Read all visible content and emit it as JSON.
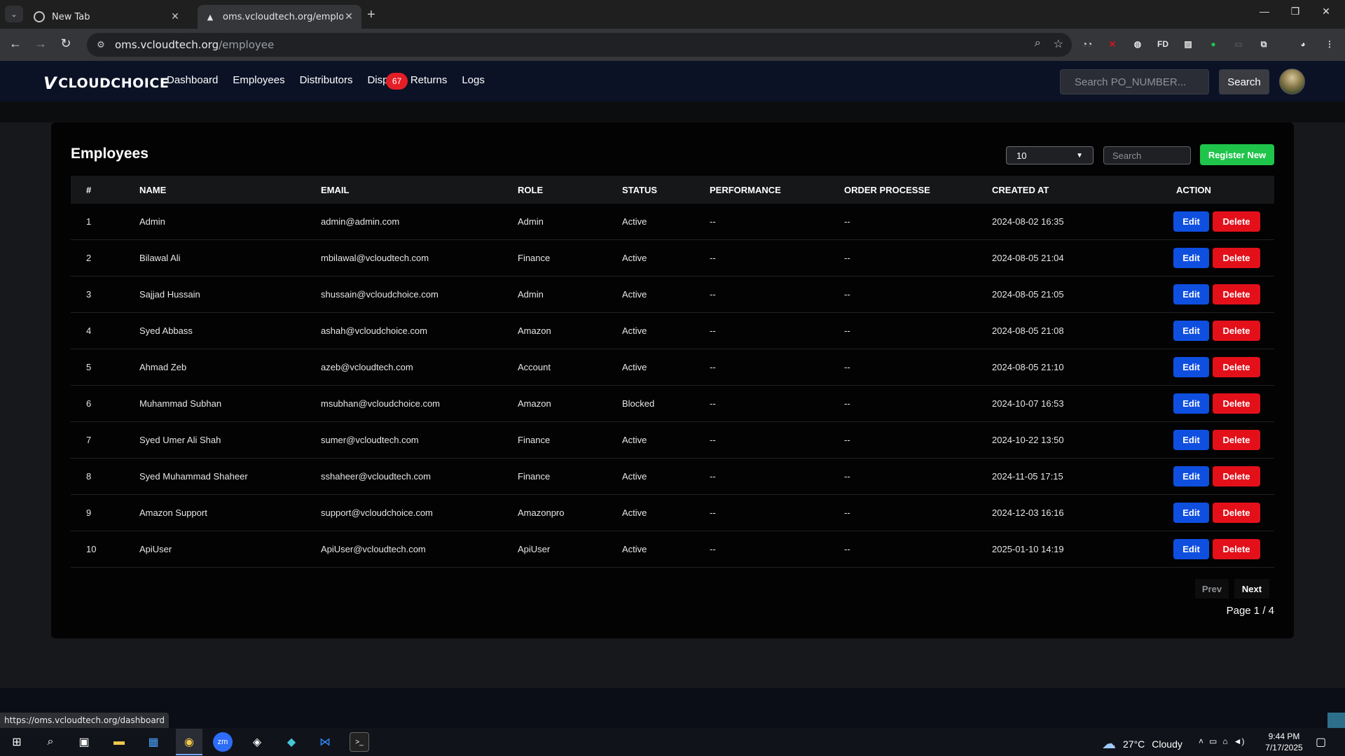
{
  "browser": {
    "tabs": [
      {
        "title": "New Tab"
      },
      {
        "title": "oms.vcloudtech.org/employee"
      }
    ],
    "url_host": "oms.vcloudtech.org",
    "url_path": "/employee",
    "status_url": "https://oms.vcloudtech.org/dashboard"
  },
  "app": {
    "logo": "CLOUDCHOICE",
    "nav": [
      "Dashboard",
      "Employees",
      "Distributors",
      "Dispu",
      "Returns",
      "Logs"
    ],
    "disputes_badge": "67",
    "search_placeholder": "Search PO_NUMBER...",
    "search_button": "Search"
  },
  "employees": {
    "title": "Employees",
    "per_page": "10",
    "search_placeholder": "Search",
    "register_button": "Register New",
    "columns": [
      "#",
      "NAME",
      "EMAIL",
      "ROLE",
      "STATUS",
      "PERFORMANCE",
      "ORDER PROCESSE",
      "CREATED AT",
      "ACTION"
    ],
    "rows": [
      {
        "n": "1",
        "name": "Admin",
        "email": "admin@admin.com",
        "role": "Admin",
        "status": "Active",
        "performance": "--",
        "orders": "--",
        "created": "2024-08-02 16:35"
      },
      {
        "n": "2",
        "name": "Bilawal Ali",
        "email": "mbilawal@vcloudtech.com",
        "role": "Finance",
        "status": "Active",
        "performance": "--",
        "orders": "--",
        "created": "2024-08-05 21:04"
      },
      {
        "n": "3",
        "name": "Sajjad Hussain",
        "email": "shussain@vcloudchoice.com",
        "role": "Admin",
        "status": "Active",
        "performance": "--",
        "orders": "--",
        "created": "2024-08-05 21:05"
      },
      {
        "n": "4",
        "name": "Syed Abbass",
        "email": "ashah@vcloudchoice.com",
        "role": "Amazon",
        "status": "Active",
        "performance": "--",
        "orders": "--",
        "created": "2024-08-05 21:08"
      },
      {
        "n": "5",
        "name": "Ahmad Zeb",
        "email": "azeb@vcloudtech.com",
        "role": "Account",
        "status": "Active",
        "performance": "--",
        "orders": "--",
        "created": "2024-08-05 21:10"
      },
      {
        "n": "6",
        "name": "Muhammad Subhan",
        "email": "msubhan@vcloudchoice.com",
        "role": "Amazon",
        "status": "Blocked",
        "performance": "--",
        "orders": "--",
        "created": "2024-10-07 16:53"
      },
      {
        "n": "7",
        "name": "Syed Umer Ali Shah",
        "email": "sumer@vcloudtech.com",
        "role": "Finance",
        "status": "Active",
        "performance": "--",
        "orders": "--",
        "created": "2024-10-22 13:50"
      },
      {
        "n": "8",
        "name": "Syed Muhammad Shaheer",
        "email": "sshaheer@vcloudtech.com",
        "role": "Finance",
        "status": "Active",
        "performance": "--",
        "orders": "--",
        "created": "2024-11-05 17:15"
      },
      {
        "n": "9",
        "name": "Amazon Support",
        "email": "support@vcloudchoice.com",
        "role": "Amazonpro",
        "status": "Active",
        "performance": "--",
        "orders": "--",
        "created": "2024-12-03 16:16"
      },
      {
        "n": "10",
        "name": "ApiUser",
        "email": "ApiUser@vcloudtech.com",
        "role": "ApiUser",
        "status": "Active",
        "performance": "--",
        "orders": "--",
        "created": "2025-01-10 14:19"
      }
    ],
    "edit_label": "Edit",
    "delete_label": "Delete",
    "prev_label": "Prev",
    "next_label": "Next",
    "page_info": "Page 1 / 4"
  },
  "taskbar": {
    "temperature": "27°C",
    "weather": "Cloudy",
    "time": "9:44 PM",
    "date": "7/17/2025"
  },
  "colors": {
    "nav_bg": "#0b1226",
    "register_green": "#1fc44b",
    "edit_blue": "#0f4fe0",
    "delete_red": "#e3101a",
    "badge_red": "#e41e26"
  }
}
